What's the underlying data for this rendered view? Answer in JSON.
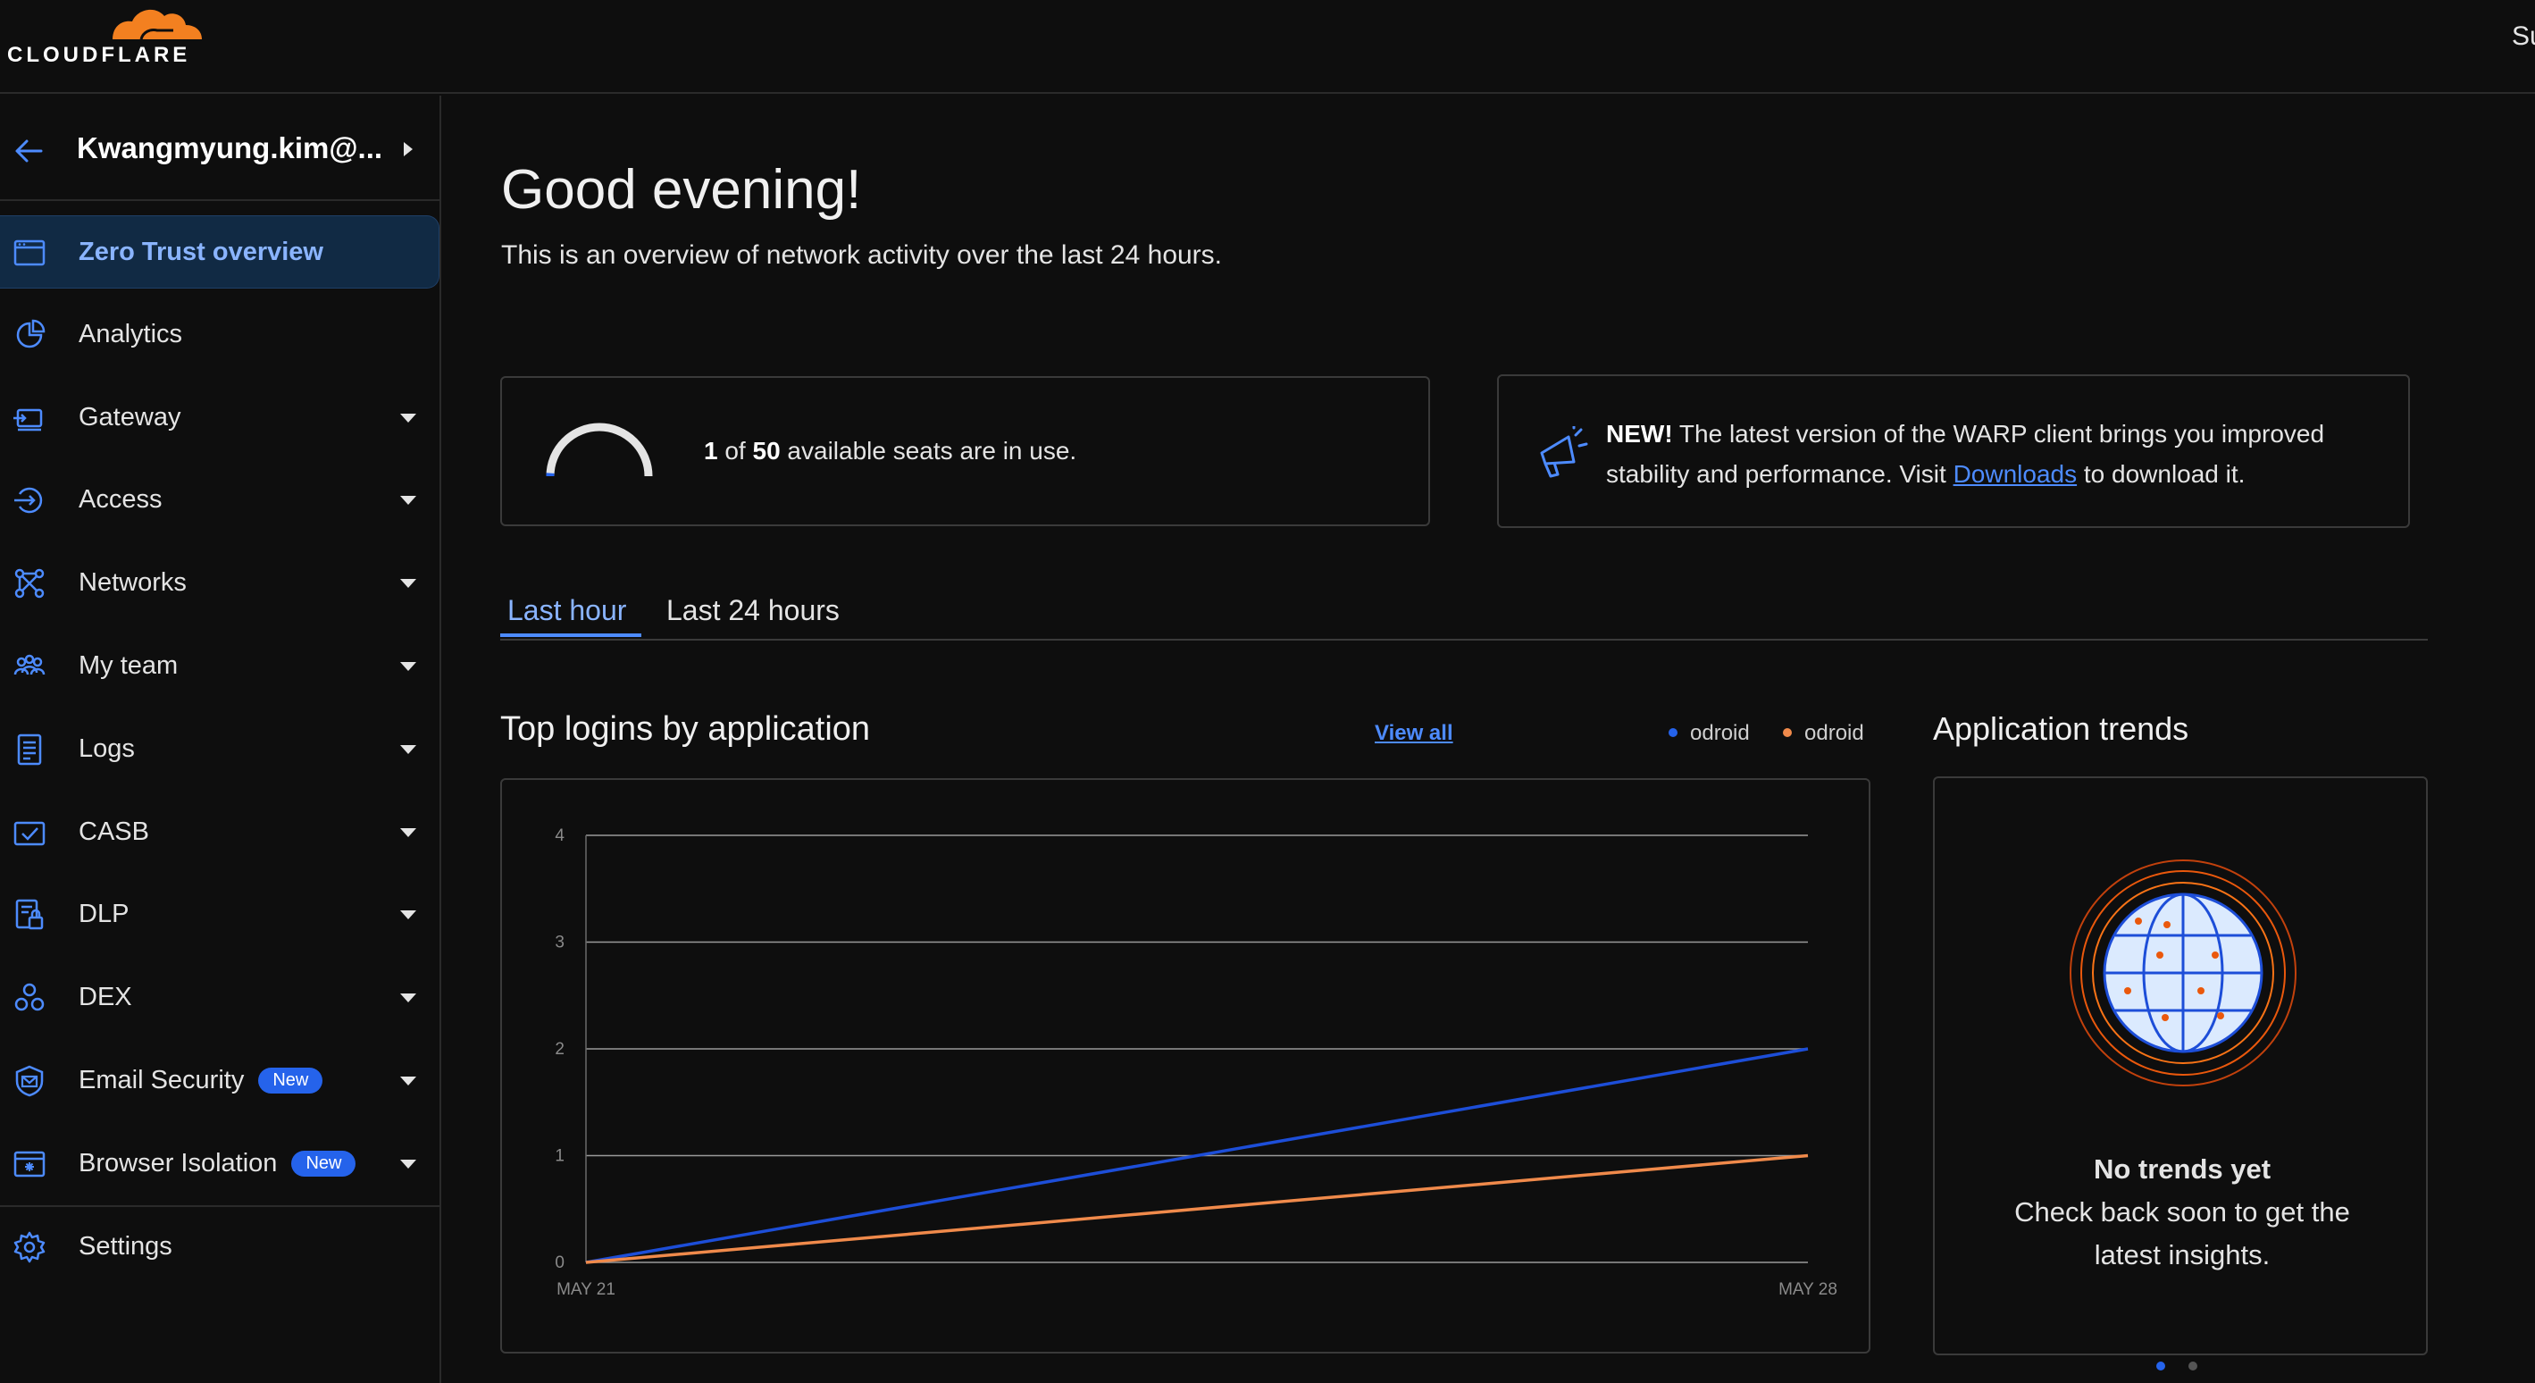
{
  "brand": {
    "name": "CLOUDFLARE",
    "top_right_cut": "Su"
  },
  "account": {
    "name": "Kwangmyung.kim@..."
  },
  "sidebar": {
    "items": [
      {
        "label": "Zero Trust overview",
        "icon": "browser-window-icon",
        "caret": false,
        "badge": ""
      },
      {
        "label": "Analytics",
        "icon": "pie-chart-icon",
        "caret": false,
        "badge": ""
      },
      {
        "label": "Gateway",
        "icon": "gateway-icon",
        "caret": true,
        "badge": ""
      },
      {
        "label": "Access",
        "icon": "access-icon",
        "caret": true,
        "badge": ""
      },
      {
        "label": "Networks",
        "icon": "network-icon",
        "caret": true,
        "badge": ""
      },
      {
        "label": "My team",
        "icon": "team-icon",
        "caret": true,
        "badge": ""
      },
      {
        "label": "Logs",
        "icon": "logs-icon",
        "caret": true,
        "badge": ""
      },
      {
        "label": "CASB",
        "icon": "casb-icon",
        "caret": true,
        "badge": ""
      },
      {
        "label": "DLP",
        "icon": "dlp-icon",
        "caret": true,
        "badge": ""
      },
      {
        "label": "DEX",
        "icon": "dex-icon",
        "caret": true,
        "badge": ""
      },
      {
        "label": "Email Security",
        "icon": "email-security-icon",
        "caret": true,
        "badge": "New"
      },
      {
        "label": "Browser Isolation",
        "icon": "browser-isolation-icon",
        "caret": true,
        "badge": "New"
      },
      {
        "label": "Settings",
        "icon": "gear-icon",
        "caret": false,
        "badge": ""
      }
    ]
  },
  "main": {
    "greeting": "Good evening!",
    "subtitle": "This is an overview of network activity over the last 24 hours.",
    "seats": {
      "used": "1",
      "of": " of ",
      "total": "50",
      "suffix": " available seats are in use.",
      "fraction_used": 0.02
    },
    "warp": {
      "new_label": "NEW!",
      "text_before": " The latest version of the WARP client brings you improved stability and performance. Visit ",
      "link": "Downloads",
      "text_after": " to download it."
    },
    "tabs": [
      "Last hour",
      "Last 24 hours"
    ],
    "active_tab": "Last hour",
    "logins": {
      "title": "Top logins by application",
      "view_all": "View all"
    },
    "trends": {
      "title": "Application trends",
      "empty_title": "No trends yet",
      "empty_text": "Check back soon to get the latest insights."
    }
  },
  "colors": {
    "accent": "#4d8bff",
    "series_blue": "#1d4ed8",
    "series_orange": "#f08a4b",
    "active_bg": "#112a44"
  },
  "chart_data": {
    "type": "line",
    "title": "Top logins by application",
    "x": [
      "MAY 21",
      "MAY 28"
    ],
    "series": [
      {
        "name": "odroid",
        "color": "#1d4ed8",
        "values": [
          0,
          2
        ]
      },
      {
        "name": "odroid",
        "color": "#f08a4b",
        "values": [
          0,
          1
        ]
      }
    ],
    "yticks": [
      0,
      1,
      2,
      3,
      4
    ],
    "ylim": [
      0,
      4
    ],
    "grid": true,
    "legend": "top-right"
  }
}
